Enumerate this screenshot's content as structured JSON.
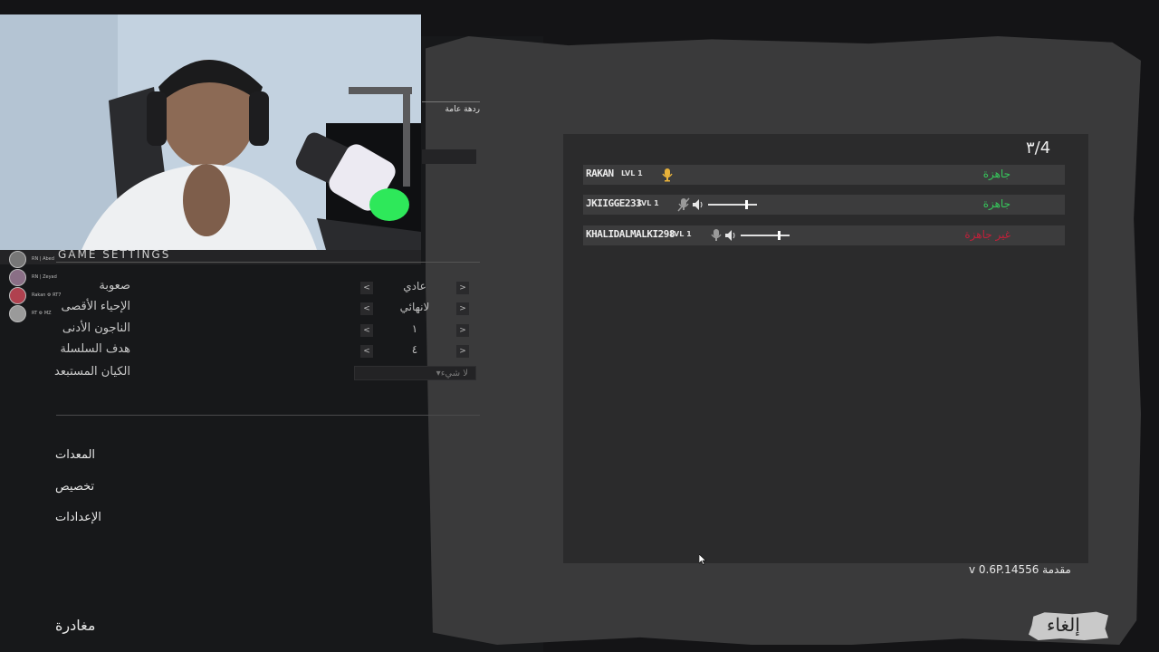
{
  "left": {
    "tab_label": "ردهة عامة",
    "section_title": "GAME SETTINGS",
    "settings": [
      {
        "label": "صعوبة",
        "value": "عادي"
      },
      {
        "label": "الإحياء الأقصى",
        "value": "لانهائي"
      },
      {
        "label": "الناجون الأدنى",
        "value": "١"
      },
      {
        "label": "هدف السلسلة",
        "value": "٤"
      }
    ],
    "excluded_entity": {
      "label": "الكيان المستبعد",
      "value": "لا شيء"
    },
    "arrow_left": "<",
    "arrow_right": ">",
    "menu": [
      "المعدات",
      "تخصيص",
      "الإعدادات"
    ],
    "exit": "مغادرة"
  },
  "stream_overlay": {
    "viewers": [
      {
        "name": "RN | Abed"
      },
      {
        "name": "RN | Zeyad"
      },
      {
        "name": "Rakan ⚙ RT7"
      },
      {
        "name": "RT ⚙ MZ"
      }
    ]
  },
  "lobby": {
    "player_count": "٣/4",
    "players": [
      {
        "name": "RAKAN",
        "level": "LVL 1",
        "mic": "active",
        "status": "جاهزة",
        "status_color": "#36c95b"
      },
      {
        "name": "JKIIGGE233",
        "level": "LVL 1",
        "mic": "muted",
        "volume": 0.8,
        "status": "جاهزة",
        "status_color": "#36c95b"
      },
      {
        "name": "KHALIDALMALKI298",
        "level": "LVL 1",
        "mic": "idle",
        "volume": 0.78,
        "status": "غير جاهزة",
        "status_color": "#c2203a"
      }
    ],
    "version": "v 0.6P.14556 مقدمة",
    "cancel": "إلغاء"
  },
  "colors": {
    "ready": "#36c95b",
    "not_ready": "#c2203a",
    "mic_active": "#e8b23a"
  }
}
